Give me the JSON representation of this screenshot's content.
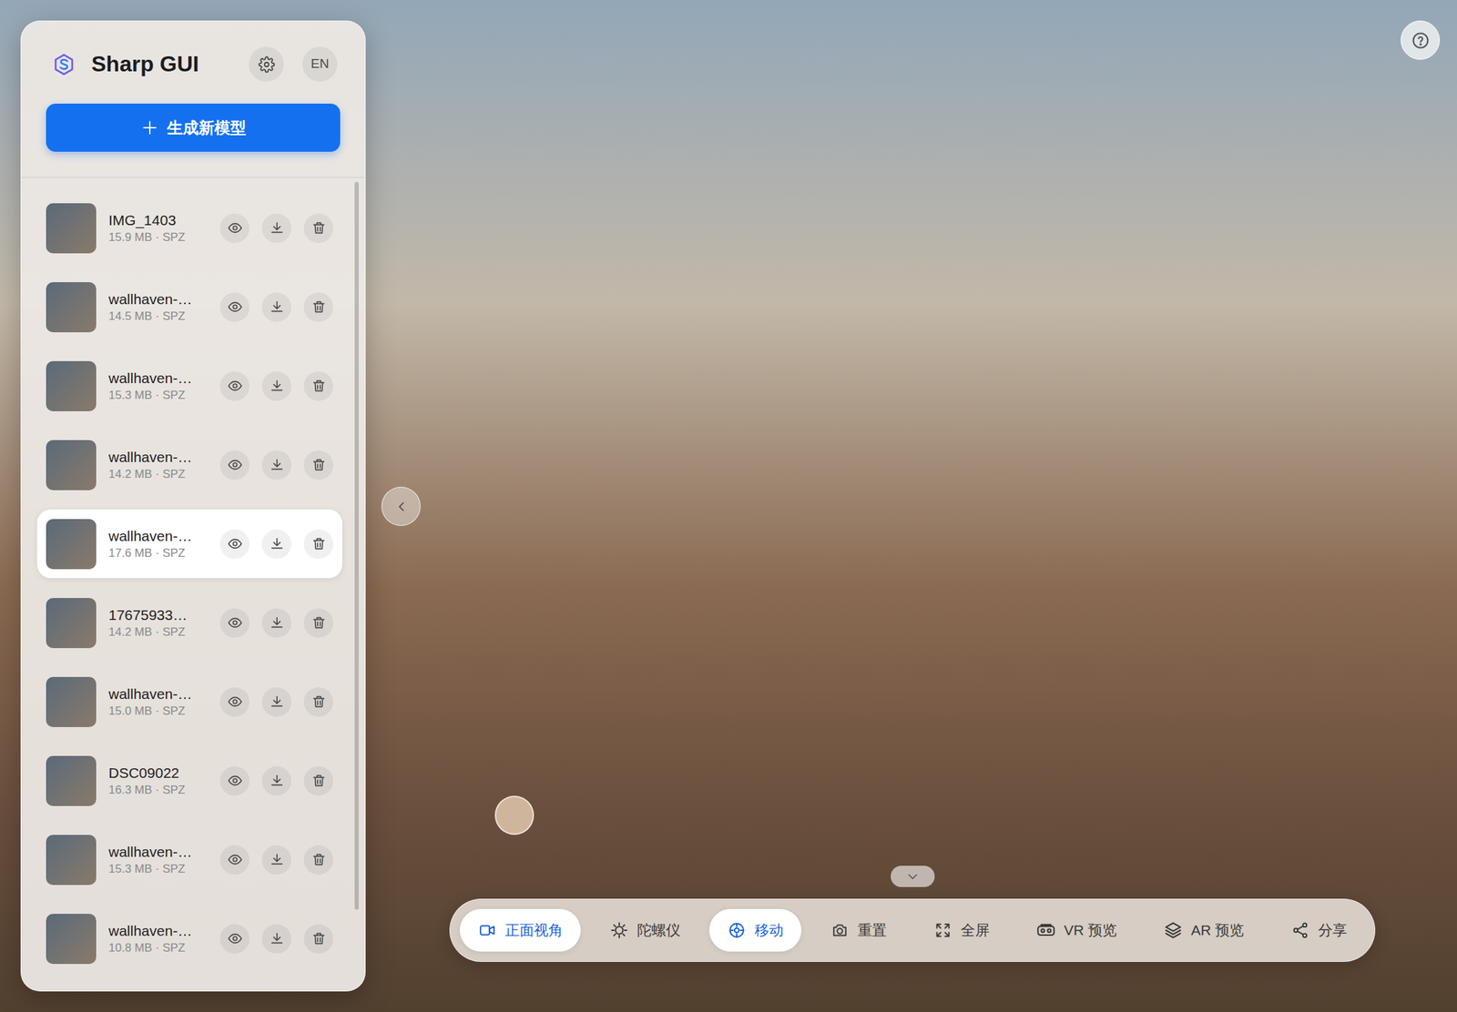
{
  "app": {
    "title": "Sharp GUI",
    "language": "EN"
  },
  "new_button": {
    "label": "生成新模型"
  },
  "models": [
    {
      "name": "IMG_1403",
      "size": "15.9 MB · SPZ",
      "selected": false
    },
    {
      "name": "wallhaven-…",
      "size": "14.5 MB · SPZ",
      "selected": false
    },
    {
      "name": "wallhaven-…",
      "size": "15.3 MB · SPZ",
      "selected": false
    },
    {
      "name": "wallhaven-…",
      "size": "14.2 MB · SPZ",
      "selected": false
    },
    {
      "name": "wallhaven-…",
      "size": "17.6 MB · SPZ",
      "selected": true
    },
    {
      "name": "17675933…",
      "size": "14.2 MB · SPZ",
      "selected": false
    },
    {
      "name": "wallhaven-…",
      "size": "15.0 MB · SPZ",
      "selected": false
    },
    {
      "name": "DSC09022",
      "size": "16.3 MB · SPZ",
      "selected": false
    },
    {
      "name": "wallhaven-…",
      "size": "15.3 MB · SPZ",
      "selected": false
    },
    {
      "name": "wallhaven-…",
      "size": "10.8 MB · SPZ",
      "selected": false
    }
  ],
  "toolbar": [
    {
      "label": "正面视角",
      "selected": true
    },
    {
      "label": "陀螺仪",
      "selected": false
    },
    {
      "label": "移动",
      "selected": true
    },
    {
      "label": "重置",
      "selected": false
    },
    {
      "label": "全屏",
      "selected": false
    },
    {
      "label": "VR 预览",
      "selected": false
    },
    {
      "label": "AR 预览",
      "selected": false
    },
    {
      "label": "分享",
      "selected": false
    }
  ]
}
